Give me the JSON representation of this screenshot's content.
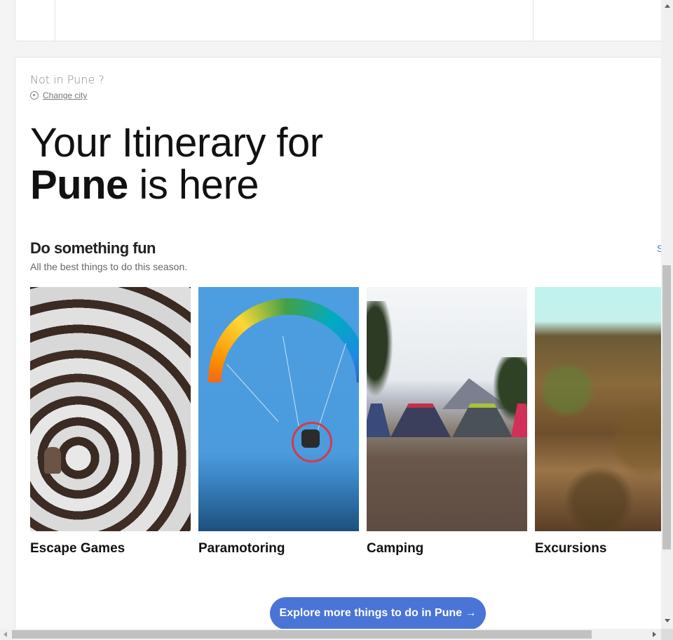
{
  "city_prompt": {
    "not_in_city": "Not in Pune ?",
    "change_city": "Change city",
    "icon": "location-pin-icon"
  },
  "headline": {
    "line1": "Your Itinerary for",
    "city": "Pune",
    "line2_rest": " is here"
  },
  "section": {
    "title": "Do something fun",
    "subtitle": "All the best things to do this season.",
    "see_all": "S"
  },
  "cards": [
    {
      "label": "Escape Games"
    },
    {
      "label": "Paramotoring"
    },
    {
      "label": "Camping"
    },
    {
      "label": "Excursions"
    }
  ],
  "explore_button": "Explore more things to do in Pune →",
  "colors": {
    "accent": "#4a74d6",
    "link": "#4a7cc9",
    "heading": "#111111"
  }
}
